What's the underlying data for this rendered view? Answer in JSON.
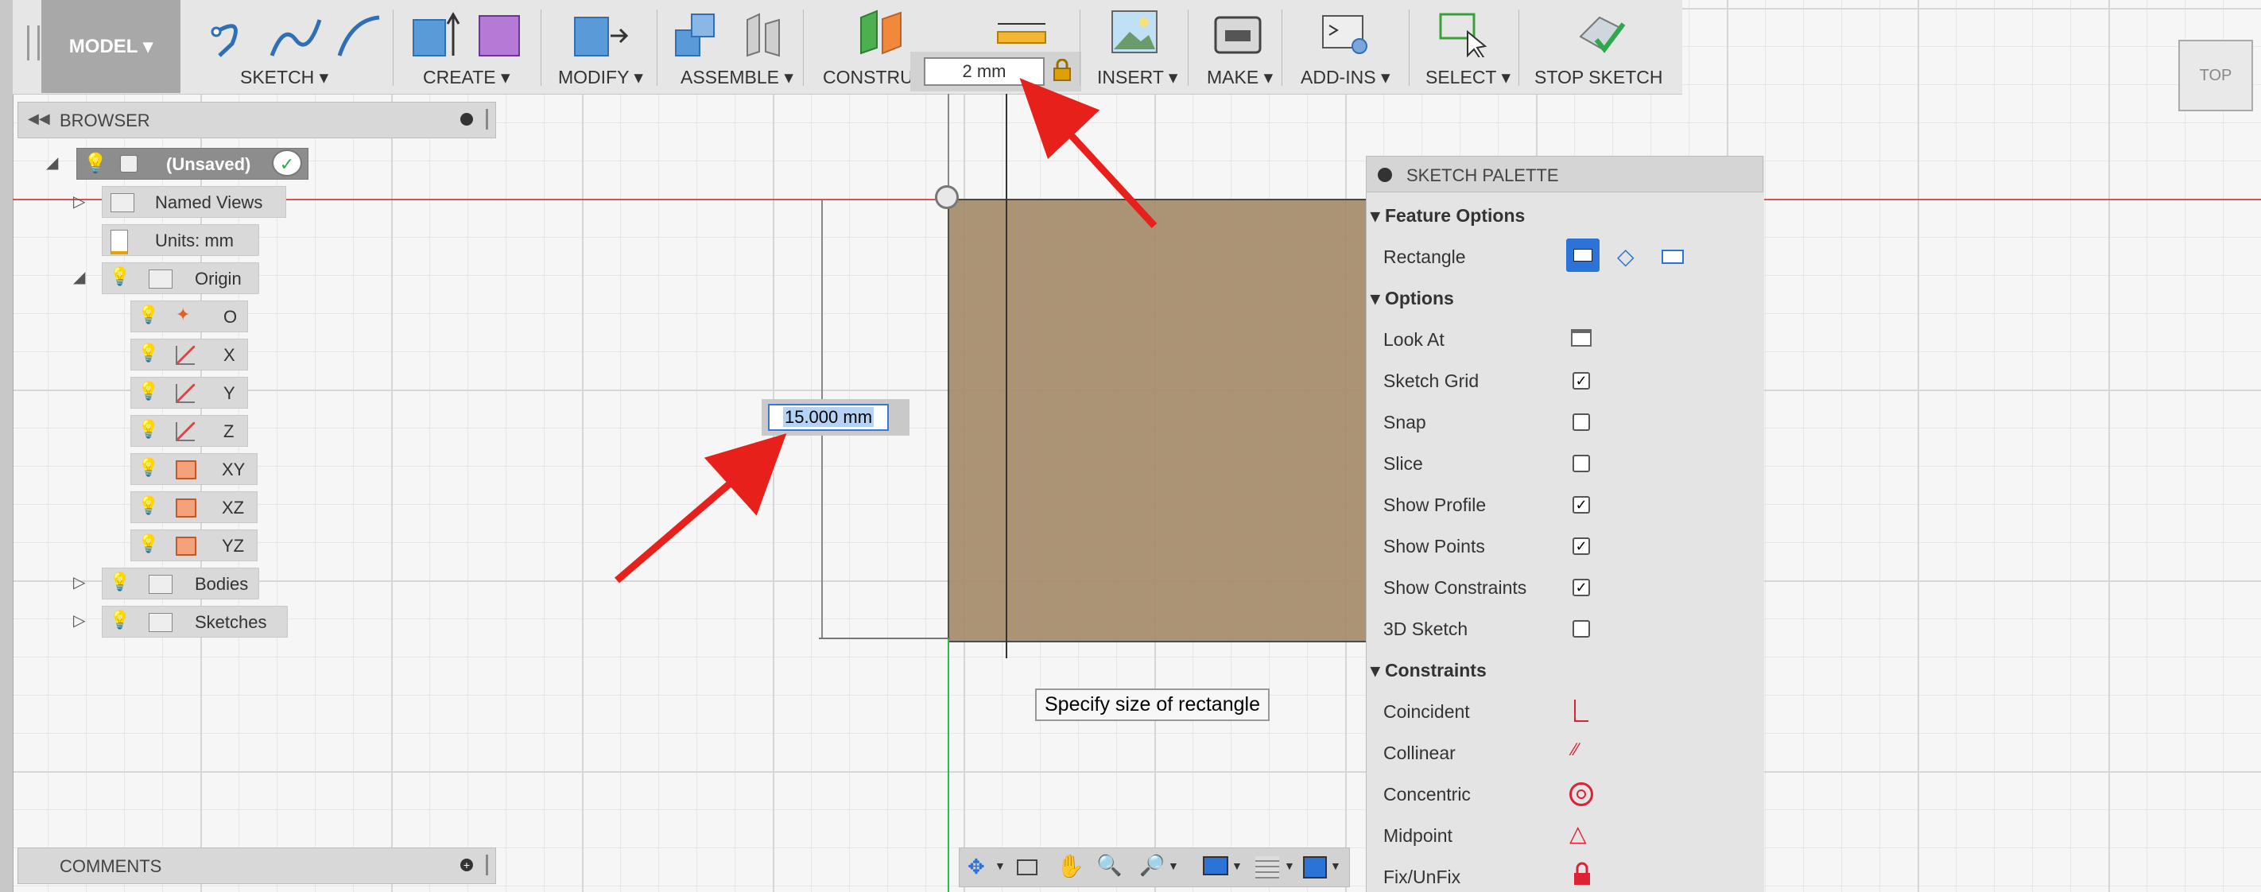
{
  "toolbar": {
    "model": "MODEL",
    "groups": [
      {
        "label": "SKETCH"
      },
      {
        "label": "CREATE"
      },
      {
        "label": "MODIFY"
      },
      {
        "label": "ASSEMBLE"
      },
      {
        "label": "CONSTRU"
      },
      {
        "label": "INSERT"
      },
      {
        "label": "MAKE"
      },
      {
        "label": "ADD-INS"
      },
      {
        "label": "SELECT"
      },
      {
        "label": "STOP SKETCH"
      }
    ],
    "dim_value": "2 mm"
  },
  "browser": {
    "title": "BROWSER",
    "root": "(Unsaved)",
    "items": [
      {
        "label": "Named Views"
      },
      {
        "label": "Units: mm"
      },
      {
        "label": "Origin"
      },
      {
        "label": "O"
      },
      {
        "label": "X"
      },
      {
        "label": "Y"
      },
      {
        "label": "Z"
      },
      {
        "label": "XY"
      },
      {
        "label": "XZ"
      },
      {
        "label": "YZ"
      },
      {
        "label": "Bodies"
      },
      {
        "label": "Sketches"
      }
    ]
  },
  "canvas": {
    "dimension_input": "15.000 mm",
    "tooltip": "Specify size of rectangle"
  },
  "palette": {
    "title": "SKETCH PALETTE",
    "feature_options": "Feature Options",
    "rectangle": "Rectangle",
    "options": "Options",
    "option_rows": [
      {
        "label": "Look At",
        "checked": null
      },
      {
        "label": "Sketch Grid",
        "checked": true
      },
      {
        "label": "Snap",
        "checked": false
      },
      {
        "label": "Slice",
        "checked": false
      },
      {
        "label": "Show Profile",
        "checked": true
      },
      {
        "label": "Show Points",
        "checked": true
      },
      {
        "label": "Show Constraints",
        "checked": true
      },
      {
        "label": "3D Sketch",
        "checked": false
      }
    ],
    "constraints": "Constraints",
    "constraint_rows": [
      {
        "label": "Coincident"
      },
      {
        "label": "Collinear"
      },
      {
        "label": "Concentric"
      },
      {
        "label": "Midpoint"
      },
      {
        "label": "Fix/UnFix"
      }
    ]
  },
  "comments": {
    "title": "COMMENTS"
  },
  "viewcube": {
    "label": "TOP"
  },
  "colors": {
    "accent": "#2b73d6",
    "sketch_fill": "#a88e6f",
    "arrow": "#e8201c"
  }
}
